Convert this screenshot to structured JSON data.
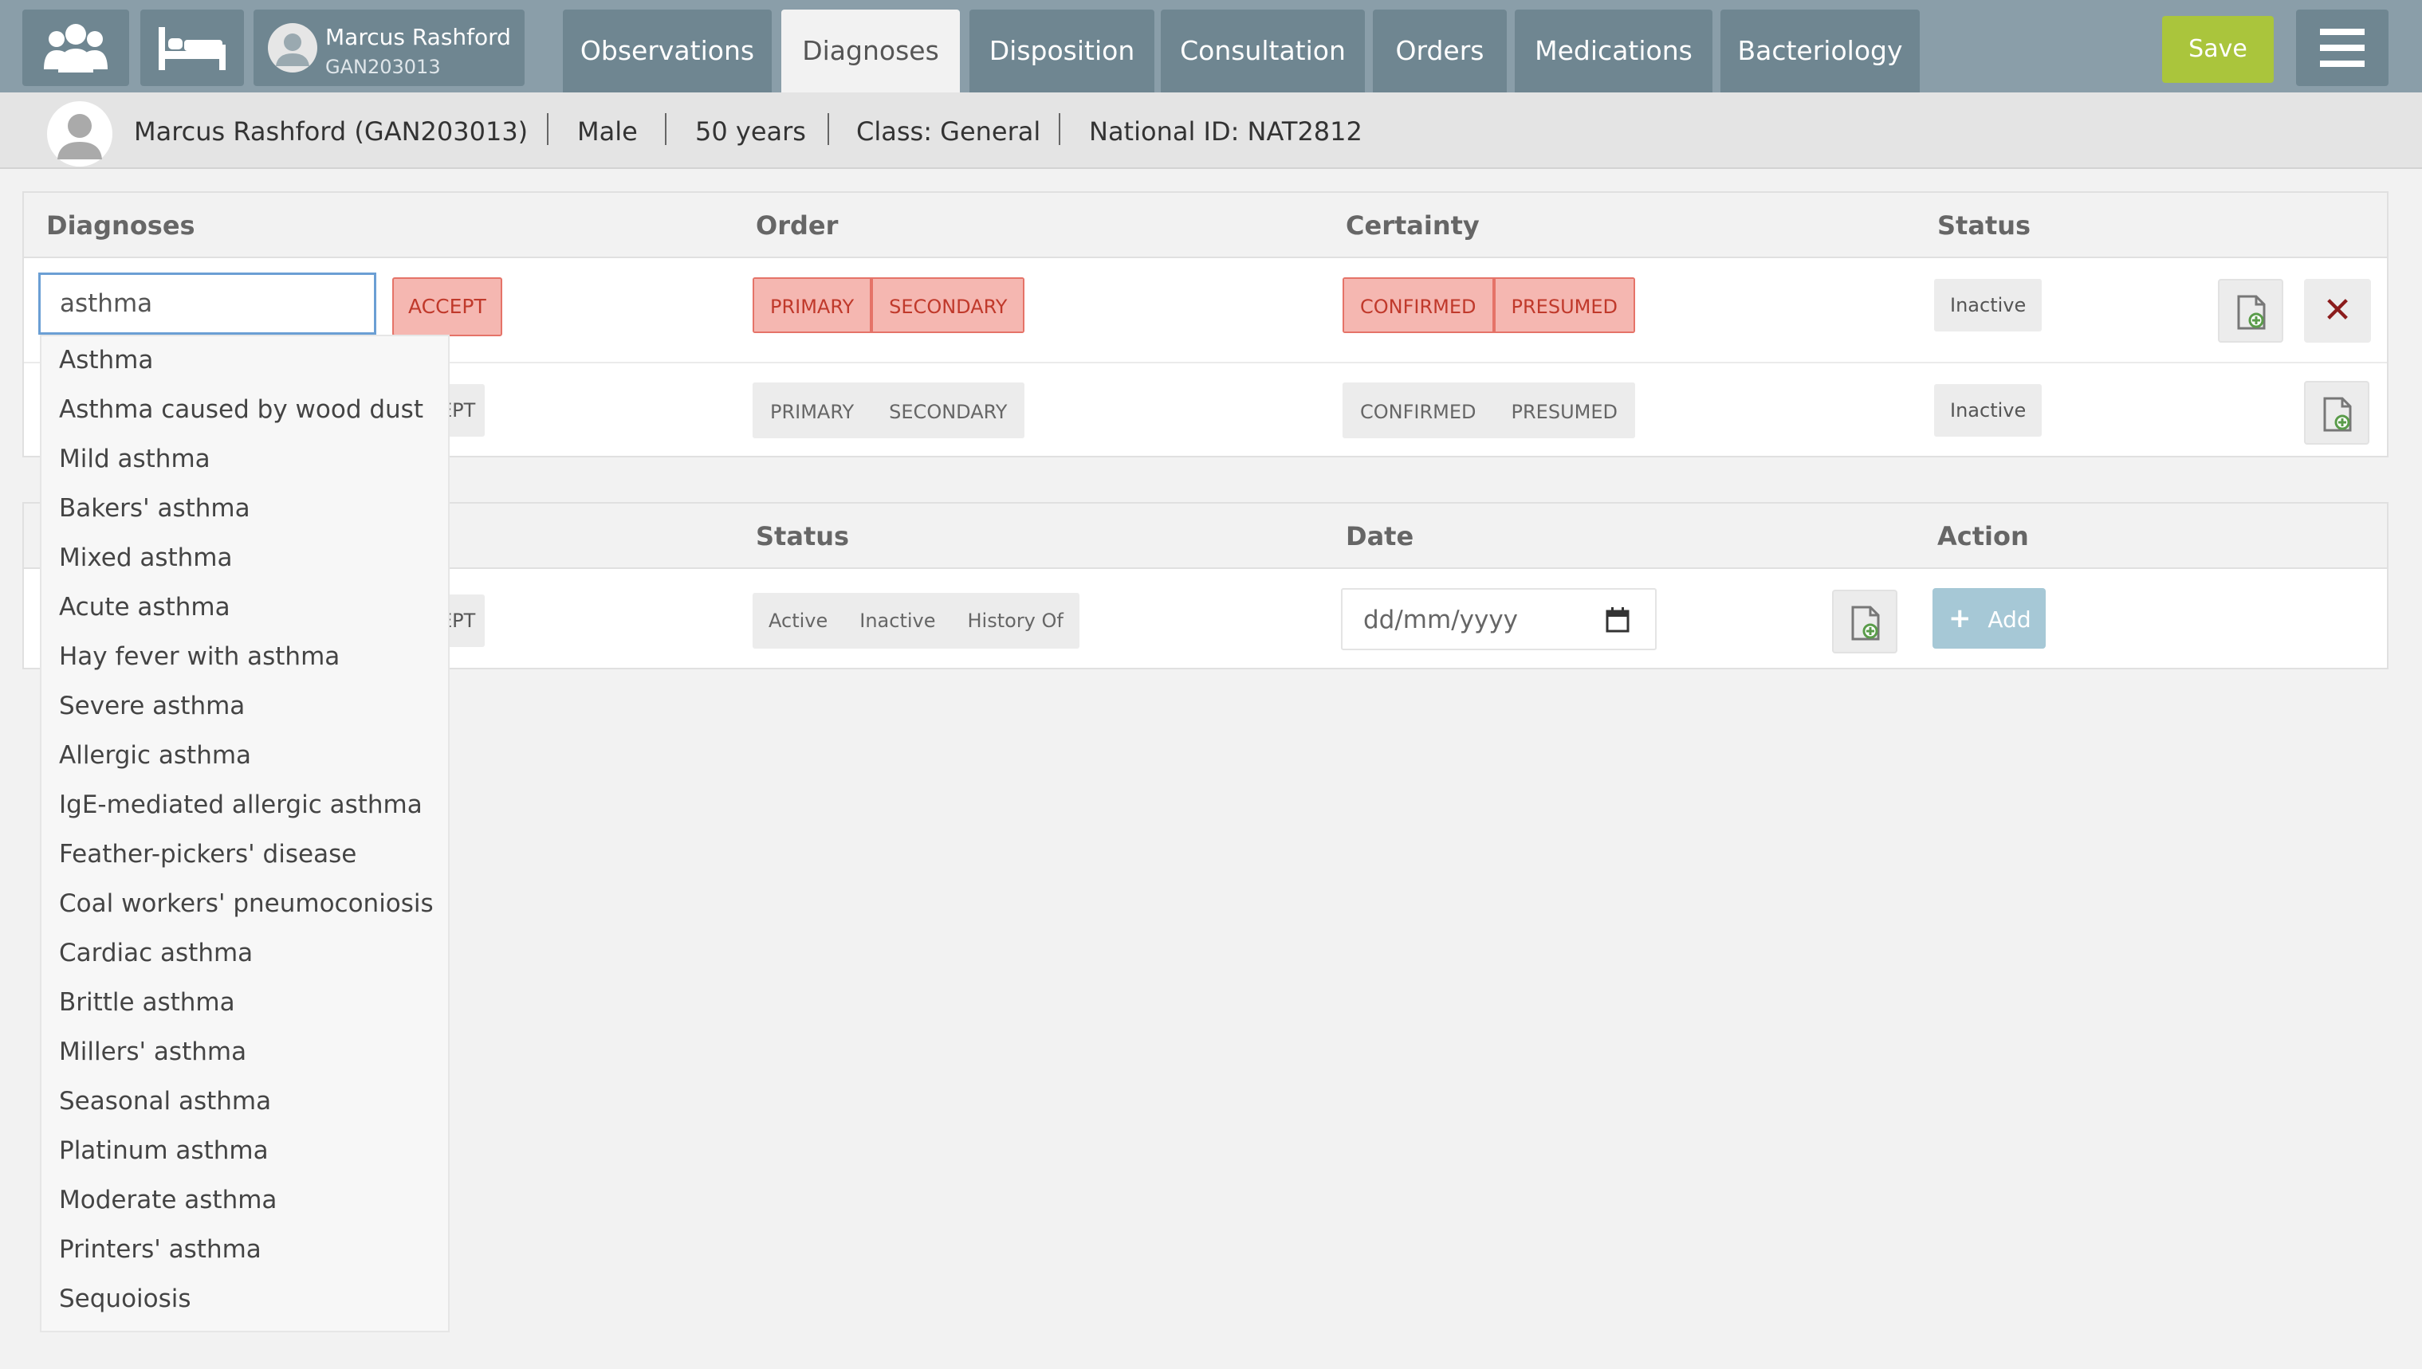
{
  "topbar": {
    "patient_name": "Marcus Rashford",
    "patient_id": "GAN203013",
    "tabs": [
      {
        "label": "Observations"
      },
      {
        "label": "Diagnoses"
      },
      {
        "label": "Disposition"
      },
      {
        "label": "Consultation"
      },
      {
        "label": "Orders"
      },
      {
        "label": "Medications"
      },
      {
        "label": "Bacteriology"
      }
    ],
    "active_tab": "Diagnoses",
    "save_label": "Save",
    "icons": [
      "users-icon",
      "bed-icon",
      "avatar-icon",
      "hamburger-menu-icon"
    ]
  },
  "patient_info": {
    "name_id": "Marcus Rashford  (GAN203013)",
    "gender": "Male",
    "age": "50 years",
    "class": "Class: General",
    "national_id": "National ID: NAT2812"
  },
  "diagnoses_panel": {
    "headers": {
      "diagnoses": "Diagnoses",
      "order": "Order",
      "certainty": "Certainty",
      "status": "Status"
    },
    "rows": [
      {
        "search_value": "asthma",
        "accept_label": "ACCEPT",
        "order_options": [
          "PRIMARY",
          "SECONDARY"
        ],
        "certainty_options": [
          "CONFIRMED",
          "PRESUMED"
        ],
        "status": "Inactive"
      },
      {
        "accept_label_partial": "EPT",
        "order_options": [
          "PRIMARY",
          "SECONDARY"
        ],
        "certainty_options": [
          "CONFIRMED",
          "PRESUMED"
        ],
        "status": "Inactive"
      }
    ]
  },
  "history_panel": {
    "headers": {
      "status": "Status",
      "date": "Date",
      "action": "Action"
    },
    "row": {
      "accept_label_partial": "EPT",
      "status_options": [
        "Active",
        "Inactive",
        "History Of"
      ],
      "date_placeholder": "dd/mm/yyyy",
      "add_label": "Add"
    }
  },
  "dropdown": {
    "items": [
      "Asthma",
      "Asthma caused by wood dust",
      "Mild asthma",
      "Bakers' asthma",
      "Mixed asthma",
      "Acute asthma",
      "Hay fever with asthma",
      "Severe asthma",
      "Allergic asthma",
      "IgE-mediated allergic asthma",
      "Feather-pickers' disease",
      "Coal workers' pneumoconiosis",
      "Cardiac asthma",
      "Brittle asthma",
      "Millers' asthma",
      "Seasonal asthma",
      "Platinum asthma",
      "Moderate asthma",
      "Printers' asthma",
      "Sequoiosis"
    ]
  },
  "colors": {
    "topbar": "#8a9ea9",
    "tab": "#6f8691",
    "save": "#aac53c",
    "selected_red": "#f5b7b1",
    "add_button": "#a6c8d6"
  }
}
